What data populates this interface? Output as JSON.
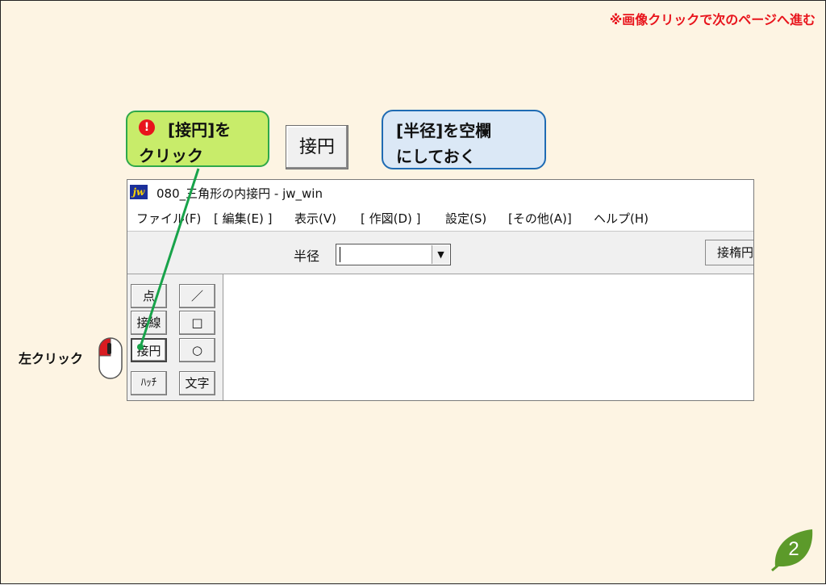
{
  "note": "※画像クリックで次のページへ進む",
  "callout_step": {
    "icon": "!",
    "line1": "[接円]を",
    "line2": "クリック"
  },
  "big_button_label": "接円",
  "callout_tip": {
    "line1": "[半径]を空欄",
    "line2": "にしておく"
  },
  "window": {
    "app_icon": "jw",
    "title": "080_三角形の内接円 - jw_win",
    "menu": [
      "ファイル(F)",
      "[ 編集(E) ]",
      "表示(V)",
      "[ 作図(D) ]",
      "設定(S)",
      "[その他(A)]",
      "ヘルプ(H)"
    ],
    "toolbar": {
      "radius_label": "半径",
      "radius_value": "",
      "right_button": "接楕円"
    },
    "tools_col1": [
      "点",
      "接線",
      "接円",
      "ﾊｯﾁ"
    ],
    "tools_col2": [
      "／",
      "□",
      "○",
      "文字"
    ]
  },
  "mouse_label": "左クリック",
  "page_number": "2",
  "colors": {
    "background": "#fdf4e3",
    "note_red": "#e8141c",
    "step_green": "#c8ec6a",
    "tip_blue": "#dbe8f6",
    "badge_green": "#5c9a2a"
  }
}
